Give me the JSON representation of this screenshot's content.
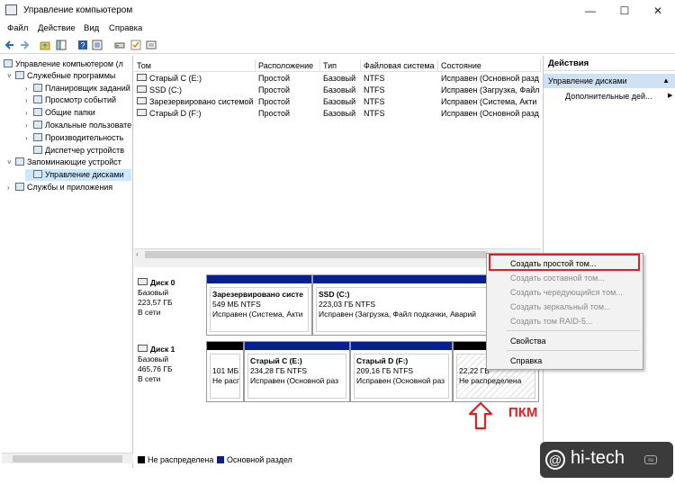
{
  "window": {
    "title": "Управление компьютером",
    "controls": {
      "minimize": "—",
      "maximize": "☐",
      "close": "✕"
    }
  },
  "menu": [
    "Файл",
    "Действие",
    "Вид",
    "Справка"
  ],
  "tree": {
    "root": "Управление компьютером (л",
    "items": [
      {
        "label": "Служебные программы"
      },
      {
        "label": "Планировщик заданий"
      },
      {
        "label": "Просмотр событий"
      },
      {
        "label": "Общие папки"
      },
      {
        "label": "Локальные пользовате"
      },
      {
        "label": "Производительность"
      },
      {
        "label": "Диспетчер устройств"
      },
      {
        "label": "Запоминающие устройст"
      },
      {
        "label": "Управление дисками"
      },
      {
        "label": "Службы и приложения"
      }
    ]
  },
  "volumes": {
    "headers": [
      "Том",
      "Расположение",
      "Тип",
      "Файловая система",
      "Состояние"
    ],
    "rows": [
      [
        "Старый C (E:)",
        "Простой",
        "Базовый",
        "NTFS",
        "Исправен (Основной разд"
      ],
      [
        "SSD (C:)",
        "Простой",
        "Базовый",
        "NTFS",
        "Исправен (Загрузка, Файл"
      ],
      [
        "Зарезервировано системой",
        "Простой",
        "Базовый",
        "NTFS",
        "Исправен (Система, Акти"
      ],
      [
        "Старый D (F:)",
        "Простой",
        "Базовый",
        "NTFS",
        "Исправен (Основной разд"
      ]
    ]
  },
  "disks": [
    {
      "name": "Диск 0",
      "type": "Базовый",
      "size": "223,57 ГБ",
      "status": "В сети",
      "partitions": [
        {
          "name": "Зарезервировано систе",
          "size": "549 МБ NTFS",
          "status": "Исправен (Система, Акти"
        },
        {
          "name": "SSD  (C:)",
          "size": "223,03 ГБ NTFS",
          "status": "Исправен (Загрузка, Файл подкачки, Аварий"
        }
      ]
    },
    {
      "name": "Диск 1",
      "type": "Базовый",
      "size": "465,76 ГБ",
      "status": "В сети",
      "partitions": [
        {
          "name": "",
          "size": "101 МБ",
          "status": "Не расп"
        },
        {
          "name": "Старый C  (E:)",
          "size": "234,28 ГБ NTFS",
          "status": "Исправен (Основной раз"
        },
        {
          "name": "Старый D  (F:)",
          "size": "209,16 ГБ NTFS",
          "status": "Исправен (Основной раз"
        },
        {
          "name": "",
          "size": "22,22 ГБ",
          "status": "Не распределена"
        }
      ]
    }
  ],
  "legend": {
    "unallocated": "Не распределена",
    "primary": "Основной раздел"
  },
  "actions": {
    "header": "Действия",
    "section": "Управление дисками",
    "more": "Дополнительные дей..."
  },
  "context_menu": {
    "items": [
      {
        "label": "Создать простой том...",
        "enabled": true
      },
      {
        "label": "Создать составной том...",
        "enabled": false
      },
      {
        "label": "Создать чередующийся том...",
        "enabled": false
      },
      {
        "label": "Создать зеркальный том...",
        "enabled": false
      },
      {
        "label": "Создать том RAID-5...",
        "enabled": false
      },
      {
        "label": "Свойства",
        "enabled": true
      },
      {
        "label": "Справка",
        "enabled": true
      }
    ]
  },
  "annotation": {
    "text": "ПКМ"
  },
  "watermark": {
    "text": "hi-tech"
  },
  "colors": {
    "primary_partition": "#0a1f8f",
    "unallocated": "#000000",
    "highlight": "#e02020",
    "selection": "#cce8ff"
  }
}
